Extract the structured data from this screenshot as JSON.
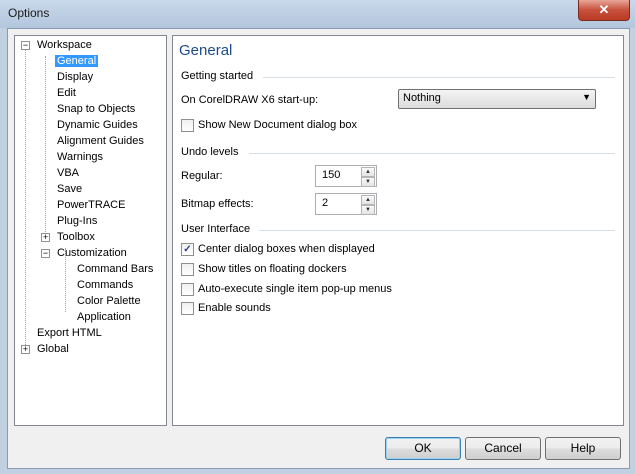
{
  "window": {
    "title": "Options",
    "close_glyph": "✕"
  },
  "tree": {
    "items": [
      {
        "label": "Workspace",
        "expander": "−"
      },
      {
        "label": "General",
        "selected": true
      },
      {
        "label": "Display"
      },
      {
        "label": "Edit"
      },
      {
        "label": "Snap to Objects"
      },
      {
        "label": "Dynamic Guides"
      },
      {
        "label": "Alignment Guides"
      },
      {
        "label": "Warnings"
      },
      {
        "label": "VBA"
      },
      {
        "label": "Save"
      },
      {
        "label": "PowerTRACE"
      },
      {
        "label": "Plug-Ins"
      },
      {
        "label": "Toolbox",
        "expander": "+"
      },
      {
        "label": "Customization",
        "expander": "−"
      },
      {
        "label": "Command Bars"
      },
      {
        "label": "Commands"
      },
      {
        "label": "Color Palette"
      },
      {
        "label": "Application"
      },
      {
        "label": "Export HTML"
      },
      {
        "label": "Global",
        "expander": "+"
      }
    ]
  },
  "page": {
    "title": "General",
    "getting_started": {
      "title": "Getting started",
      "startup_label": "On CorelDRAW X6 start-up:",
      "startup_value": "Nothing",
      "show_new_doc_label": "Show New Document dialog box",
      "show_new_doc_checked": false
    },
    "undo": {
      "title": "Undo levels",
      "regular_label": "Regular:",
      "regular_value": "150",
      "bitmap_label": "Bitmap effects:",
      "bitmap_value": "2"
    },
    "ui": {
      "title": "User Interface",
      "options": [
        {
          "label": "Center dialog boxes when displayed",
          "checked": true,
          "mark": "✓"
        },
        {
          "label": "Show titles on floating dockers",
          "checked": false,
          "mark": ""
        },
        {
          "label": "Auto-execute single item pop-up menus",
          "checked": false,
          "mark": ""
        },
        {
          "label": "Enable sounds",
          "checked": false,
          "mark": ""
        }
      ]
    }
  },
  "buttons": {
    "ok": "OK",
    "cancel": "Cancel",
    "help": "Help"
  },
  "icons": {
    "dropdown": "▼",
    "spin_up": "▲",
    "spin_down": "▼"
  }
}
